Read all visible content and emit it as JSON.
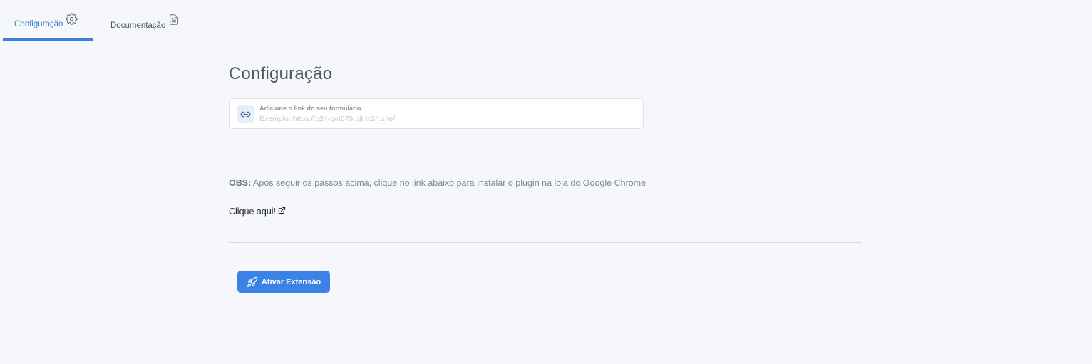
{
  "tabs": [
    {
      "label": "Configuração",
      "icon": "gear-icon",
      "active": true
    },
    {
      "label": "Documentação",
      "icon": "document-icon",
      "active": false
    }
  ],
  "main": {
    "title": "Configuração",
    "link_field": {
      "label": "Adicione o link do seu formulário",
      "placeholder": "Exemplo: https://b24-qnt079.bitrix24.site/",
      "value": "",
      "icon": "link-icon"
    },
    "obs": {
      "prefix": "OBS:",
      "text": " Após seguir os passos acima, clique no link abaixo para instalar o plugin na loja do Google Chrome"
    },
    "install_link": {
      "label": "Clique aqui!",
      "icon": "external-link-icon"
    },
    "activate_button": {
      "label": "Ativar Extensão",
      "icon": "rocket-icon"
    }
  },
  "colors": {
    "accent": "#3b82e6",
    "tab_active": "#3b7fd9",
    "background": "#f5f7fa",
    "text_dark": "#4b5862",
    "text_muted": "#7e8893"
  }
}
